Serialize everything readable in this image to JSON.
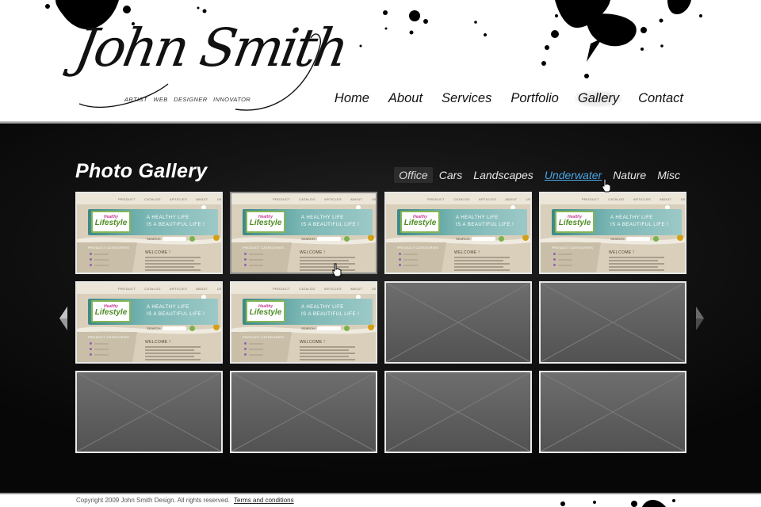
{
  "brand": {
    "name": "John Smith",
    "tagline": "ARTIST WEB DESIGNER INNOVATOR"
  },
  "nav": {
    "items": [
      "Home",
      "About",
      "Services",
      "Portfolio",
      "Gallery",
      "Contact"
    ],
    "active": "Gallery"
  },
  "gallery": {
    "title": "Photo Gallery",
    "filters": [
      "Office",
      "Cars",
      "Landscapes",
      "Underwater",
      "Nature",
      "Misc"
    ],
    "active_filter": "Office",
    "hovered_filter": "Underwater",
    "preview": {
      "menu": "PRODUCT CATALOG   ARTICLES   ABOUT US",
      "logo_top": "Healthy",
      "logo_main": "Lifestyle",
      "headline_1": "A HEALTHY LIFE",
      "headline_2": "IS A BEAUTIFUL LIFE !",
      "search_label": "SEARCH:",
      "category_title": "PRODUCT CATEGORIES",
      "welcome": "WELCOME !"
    },
    "thumbnails": [
      {
        "kind": "preview"
      },
      {
        "kind": "preview",
        "selected": true
      },
      {
        "kind": "preview"
      },
      {
        "kind": "preview"
      },
      {
        "kind": "preview"
      },
      {
        "kind": "preview"
      },
      {
        "kind": "placeholder"
      },
      {
        "kind": "placeholder"
      },
      {
        "kind": "placeholder"
      },
      {
        "kind": "placeholder"
      },
      {
        "kind": "placeholder"
      },
      {
        "kind": "placeholder"
      }
    ]
  },
  "footer": {
    "copyright": "Copyright 2009 John Smith Design. All rights reserved.",
    "terms_link": "Terms and conditions"
  },
  "colors": {
    "filter_hover": "#4aa6e6",
    "content_bg": "#121212",
    "placeholder": "#6a6a6a",
    "thumb_border": "#e8e8e8"
  },
  "icons": [
    "prev-arrow-icon",
    "next-arrow-icon",
    "hand-cursor-icon"
  ]
}
